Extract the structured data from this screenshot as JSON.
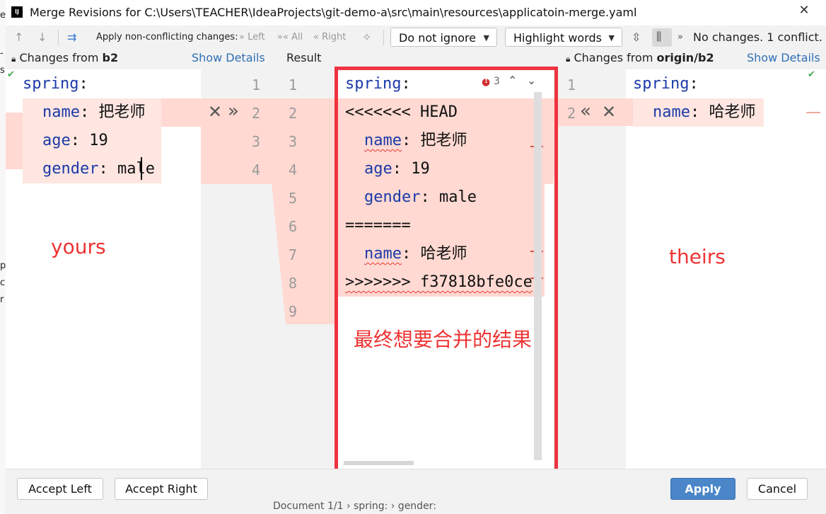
{
  "window": {
    "title": "Merge Revisions for C:\\Users\\TEACHER\\IdeaProjects\\git-demo-a\\src\\main\\resources\\applicatoin-merge.yaml",
    "close_icon": "close-icon"
  },
  "toolbar": {
    "apply_label": "Apply non-conflicting changes:",
    "left_label": "Left",
    "all_label": "All",
    "right_label": "Right",
    "ignore_value": "Do not ignore",
    "highlight_value": "Highlight words",
    "status": "No changes. 1 conflict."
  },
  "panels": {
    "left_header_prefix": "Changes from",
    "left_header_branch": "b2",
    "left_show_details": "Show Details",
    "center_header": "Result",
    "right_header_prefix": "Changes from",
    "right_header_branch": "origin/b2",
    "right_show_details": "Show Details"
  },
  "left_code": {
    "l1_key": "spring",
    "l2_key": "name",
    "l2_val": " 把老师",
    "l3_key": "age",
    "l3_val": " 19",
    "l4_key": "gender",
    "l4_val": " male",
    "line_numbers": [
      "1",
      "2",
      "3",
      "4"
    ]
  },
  "center_code": {
    "l1_key": "spring",
    "l2": "<<<<<<< HEAD",
    "l3_key": "name",
    "l3_val": " 把老师",
    "l4_key": "age",
    "l4_val": " 19",
    "l5_key": "gender",
    "l5_val": " male",
    "l6": "=======",
    "l7_key": "name",
    "l7_val": " 哈老师",
    "l8": ">>>>>>> f37818bfe0ce",
    "line_numbers": [
      "1",
      "2",
      "3",
      "4",
      "5",
      "6",
      "7",
      "8",
      "9"
    ],
    "error_count": "3"
  },
  "right_code": {
    "l1_key": "spring",
    "l2_key": "name",
    "l2_val": " 哈老师",
    "line_numbers": [
      "1",
      "2"
    ]
  },
  "annotations": {
    "yours": "yours",
    "theirs": "theirs",
    "result": "最终想要合并的结果"
  },
  "footer": {
    "accept_left": "Accept Left",
    "accept_right": "Accept Right",
    "apply": "Apply",
    "cancel": "Cancel",
    "status": "Document 1/1 › spring: › gender:"
  },
  "colors": {
    "conflict_bg": "#ffd9d2",
    "annotation_red": "#ee3333",
    "link_blue": "#2f6fb6",
    "primary_button": "#4a86c8",
    "keyword": "#1c3aa8"
  }
}
